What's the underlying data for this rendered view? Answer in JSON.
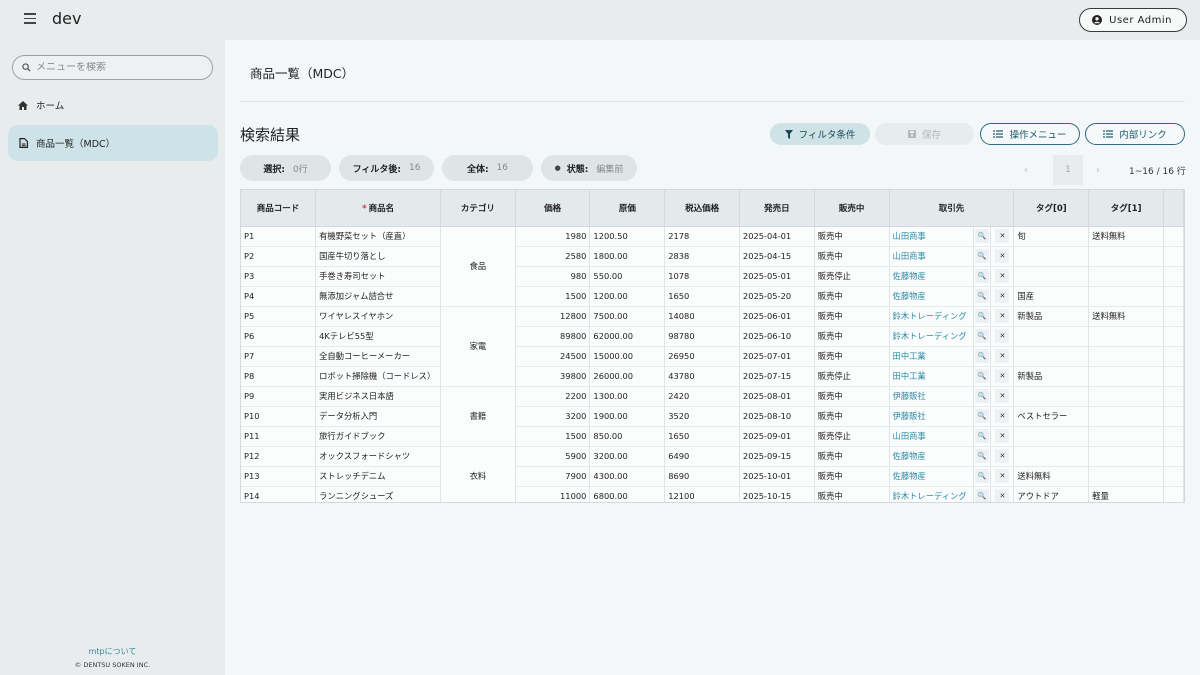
{
  "app": {
    "title": "dev",
    "user_label": "User Admin"
  },
  "sidebar": {
    "search_placeholder": "メニューを検索",
    "items": [
      {
        "label": "ホーム",
        "icon": "home-icon"
      },
      {
        "label": "商品一覧（MDC）",
        "icon": "document-icon",
        "active": true
      }
    ],
    "about_link": "mtpについて",
    "copyright": "© DENTSU SOKEN INC."
  },
  "main": {
    "page_title": "商品一覧（MDC）",
    "section_title": "検索結果",
    "buttons": {
      "filter": "フィルタ条件",
      "save": "保存",
      "ops": "操作メニュー",
      "link": "内部リンク"
    },
    "chips": {
      "selected_label": "選択:",
      "selected_value": "0行",
      "filtered_label": "フィルタ後:",
      "filtered_value": "16",
      "all_label": "全体:",
      "all_value": "16",
      "state_label": "状態:",
      "state_value": "編集前"
    },
    "pager": {
      "current": "1",
      "info": "1~16 / 16 行"
    }
  },
  "table": {
    "columns": [
      "商品コード",
      "商品名",
      "カテゴリ",
      "価格",
      "原価",
      "税込価格",
      "発売日",
      "販売中",
      "取引先",
      "タグ[0]",
      "タグ[1]"
    ],
    "required_marker": "*",
    "categories": [
      {
        "name": "食品",
        "rows": 4
      },
      {
        "name": "家電",
        "rows": 4
      },
      {
        "name": "書籍",
        "rows": 3
      },
      {
        "name": "衣料",
        "rows": 3
      }
    ],
    "rows": [
      [
        "P1",
        "有機野菜セット（産直）",
        "1980",
        "1200.50",
        "2178",
        "2025-04-01",
        "販売中",
        "山田商事",
        "旬",
        "送料無料"
      ],
      [
        "P2",
        "国産牛切り落とし",
        "2580",
        "1800.00",
        "2838",
        "2025-04-15",
        "販売中",
        "山田商事",
        "",
        ""
      ],
      [
        "P3",
        "手巻き寿司セット",
        "980",
        "550.00",
        "1078",
        "2025-05-01",
        "販売停止",
        "佐藤物産",
        "",
        ""
      ],
      [
        "P4",
        "無添加ジャム詰合せ",
        "1500",
        "1200.00",
        "1650",
        "2025-05-20",
        "販売中",
        "佐藤物産",
        "国産",
        ""
      ],
      [
        "P5",
        "ワイヤレスイヤホン",
        "12800",
        "7500.00",
        "14080",
        "2025-06-01",
        "販売中",
        "鈴木トレーディング",
        "新製品",
        "送料無料"
      ],
      [
        "P6",
        "4Kテレビ55型",
        "89800",
        "62000.00",
        "98780",
        "2025-06-10",
        "販売中",
        "鈴木トレーディング",
        "",
        ""
      ],
      [
        "P7",
        "全自動コーヒーメーカー",
        "24500",
        "15000.00",
        "26950",
        "2025-07-01",
        "販売中",
        "田中工業",
        "",
        ""
      ],
      [
        "P8",
        "ロボット掃除機（コードレス）",
        "39800",
        "26000.00",
        "43780",
        "2025-07-15",
        "販売停止",
        "田中工業",
        "新製品",
        ""
      ],
      [
        "P9",
        "実用ビジネス日本語",
        "2200",
        "1300.00",
        "2420",
        "2025-08-01",
        "販売中",
        "伊藤販社",
        "",
        ""
      ],
      [
        "P10",
        "データ分析入門",
        "3200",
        "1900.00",
        "3520",
        "2025-08-10",
        "販売中",
        "伊藤販社",
        "ベストセラー",
        ""
      ],
      [
        "P11",
        "旅行ガイドブック",
        "1500",
        "850.00",
        "1650",
        "2025-09-01",
        "販売停止",
        "山田商事",
        "",
        ""
      ],
      [
        "P12",
        "オックスフォードシャツ",
        "5900",
        "3200.00",
        "6490",
        "2025-09-15",
        "販売中",
        "佐藤物産",
        "",
        ""
      ],
      [
        "P13",
        "ストレッチデニム",
        "7900",
        "4300.00",
        "8690",
        "2025-10-01",
        "販売中",
        "佐藤物産",
        "送料無料",
        ""
      ],
      [
        "P14",
        "ランニングシューズ",
        "11000",
        "6800.00",
        "12100",
        "2025-10-15",
        "販売中",
        "鈴木トレーディング",
        "アウトドア",
        "軽量"
      ]
    ],
    "row_buttons": {
      "search": "🔍",
      "clear": "✕"
    }
  },
  "colors": {
    "accent": "#2a8aa3",
    "active_nav": "#cde3e8",
    "required": "#c7363a"
  }
}
